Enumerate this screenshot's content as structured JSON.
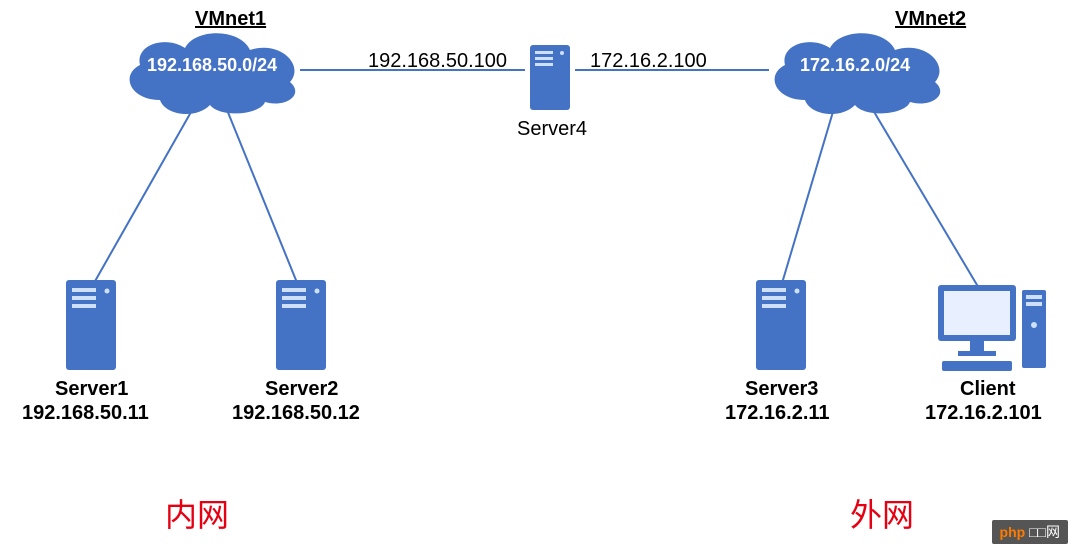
{
  "networks": {
    "vmnet1": {
      "title": "VMnet1",
      "subnet": "192.168.50.0/24"
    },
    "vmnet2": {
      "title": "VMnet2",
      "subnet": "172.16.2.0/24"
    }
  },
  "nodes": {
    "server1": {
      "name": "Server1",
      "ip": "192.168.50.11"
    },
    "server2": {
      "name": "Server2",
      "ip": "192.168.50.12"
    },
    "server3": {
      "name": "Server3",
      "ip": "172.16.2.11"
    },
    "server4": {
      "name": "Server4",
      "left_ip": "192.168.50.100",
      "right_ip": "172.16.2.100"
    },
    "client": {
      "name": "Client",
      "ip": "172.16.2.101"
    }
  },
  "zones": {
    "internal": "内网",
    "external": "外网"
  },
  "watermark": {
    "brand": "php",
    "suffix": "□□网"
  },
  "chart_data": {
    "type": "network-diagram",
    "networks": [
      {
        "id": "VMnet1",
        "subnet": "192.168.50.0/24",
        "zone": "内网"
      },
      {
        "id": "VMnet2",
        "subnet": "172.16.2.0/24",
        "zone": "外网"
      }
    ],
    "hosts": [
      {
        "id": "Server1",
        "type": "server",
        "ip": "192.168.50.11",
        "network": "VMnet1"
      },
      {
        "id": "Server2",
        "type": "server",
        "ip": "192.168.50.12",
        "network": "VMnet1"
      },
      {
        "id": "Server4",
        "type": "server-router",
        "ips": [
          "192.168.50.100",
          "172.16.2.100"
        ],
        "networks": [
          "VMnet1",
          "VMnet2"
        ]
      },
      {
        "id": "Server3",
        "type": "server",
        "ip": "172.16.2.11",
        "network": "VMnet2"
      },
      {
        "id": "Client",
        "type": "pc",
        "ip": "172.16.2.101",
        "network": "VMnet2"
      }
    ],
    "links": [
      {
        "from": "VMnet1",
        "to": "Server1"
      },
      {
        "from": "VMnet1",
        "to": "Server2"
      },
      {
        "from": "VMnet1",
        "to": "Server4"
      },
      {
        "from": "Server4",
        "to": "VMnet2"
      },
      {
        "from": "VMnet2",
        "to": "Server3"
      },
      {
        "from": "VMnet2",
        "to": "Client"
      }
    ]
  }
}
